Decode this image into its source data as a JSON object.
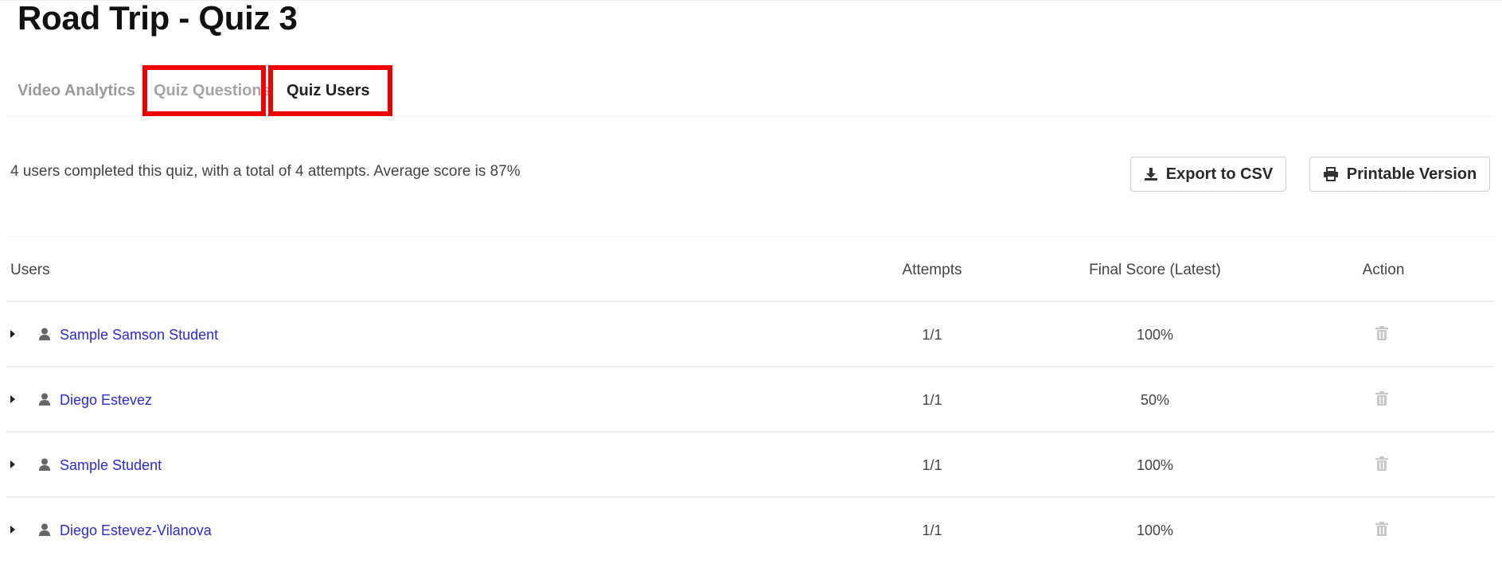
{
  "page": {
    "title": "Road Trip - Quiz 3"
  },
  "tabs": [
    {
      "label": "Video Analytics",
      "state": "inactive"
    },
    {
      "label": "Quiz Questions",
      "state": "inactive",
      "highlighted": true
    },
    {
      "label": "Quiz Users",
      "state": "active",
      "highlighted": true
    }
  ],
  "summary": {
    "text": "4 users completed this quiz, with a total of 4 attempts. Average score is 87%"
  },
  "buttons": {
    "export_label": "Export to CSV",
    "export_icon": "download-icon",
    "print_label": "Printable Version",
    "print_icon": "printer-icon"
  },
  "table": {
    "columns": [
      "Users",
      "Attempts",
      "Final Score (Latest)",
      "Action"
    ],
    "rows": [
      {
        "user": "Sample Samson Student",
        "attempts": "1/1",
        "score": "100%",
        "action_icon": "trash-icon"
      },
      {
        "user": "Diego Estevez",
        "attempts": "1/1",
        "score": "50%",
        "action_icon": "trash-icon"
      },
      {
        "user": "Sample Student",
        "attempts": "1/1",
        "score": "100%",
        "action_icon": "trash-icon"
      },
      {
        "user": "Diego Estevez-Vilanova",
        "attempts": "1/1",
        "score": "100%",
        "action_icon": "trash-icon"
      }
    ]
  },
  "colors": {
    "highlight": "#ee0000",
    "link": "#2b2bd4",
    "inactive_tab": "#9a9a9a"
  }
}
